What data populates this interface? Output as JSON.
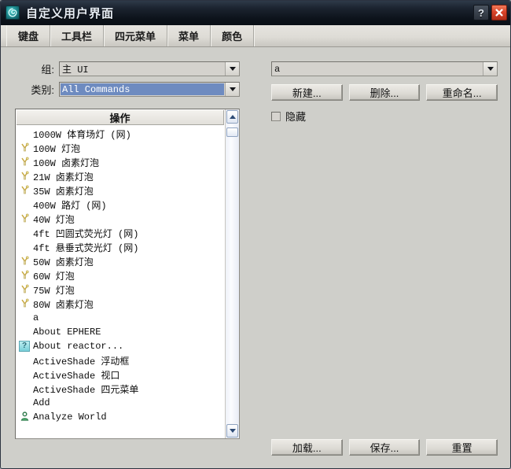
{
  "window": {
    "title": "自定义用户界面",
    "app_icon": "max-swirl-icon",
    "help_label": "?",
    "close_label": "×",
    "frame_color": "#2c3340",
    "body_color": "#cfcfca"
  },
  "tabs": [
    {
      "label": "键盘"
    },
    {
      "label": "工具栏"
    },
    {
      "label": "四元菜单"
    },
    {
      "label": "菜单"
    },
    {
      "label": "颜色"
    }
  ],
  "left_panel": {
    "group": {
      "label": "组:",
      "value": "主 UI"
    },
    "category": {
      "label": "类别:",
      "value": "All Commands",
      "selected": true,
      "highlight_color": "#6e8bc0"
    },
    "list": {
      "header": "操作",
      "rows": [
        {
          "icon": "none",
          "label": "1000W 体育场灯 (网)"
        },
        {
          "icon": "lamp",
          "label": "100W 灯泡"
        },
        {
          "icon": "lamp",
          "label": "100W 卤素灯泡"
        },
        {
          "icon": "lamp",
          "label": "21W 卤素灯泡"
        },
        {
          "icon": "lamp",
          "label": "35W 卤素灯泡"
        },
        {
          "icon": "none",
          "label": "400W 路灯 (网)"
        },
        {
          "icon": "lamp",
          "label": "40W 灯泡"
        },
        {
          "icon": "none",
          "label": "4ft 凹圆式荧光灯 (网)"
        },
        {
          "icon": "none",
          "label": "4ft 悬垂式荧光灯 (网)"
        },
        {
          "icon": "lamp",
          "label": "50W 卤素灯泡"
        },
        {
          "icon": "lamp",
          "label": "60W 灯泡"
        },
        {
          "icon": "lamp",
          "label": "75W 灯泡"
        },
        {
          "icon": "lamp",
          "label": "80W 卤素灯泡"
        },
        {
          "icon": "none",
          "label": "a"
        },
        {
          "icon": "none",
          "label": "About EPHERE"
        },
        {
          "icon": "question",
          "label": "About reactor..."
        },
        {
          "icon": "none",
          "label": "ActiveShade 浮动框"
        },
        {
          "icon": "none",
          "label": "ActiveShade 视口"
        },
        {
          "icon": "none",
          "label": "ActiveShade 四元菜单"
        },
        {
          "icon": "none",
          "label": "Add"
        },
        {
          "icon": "person",
          "label": "Analyze World"
        },
        {
          "icon": "none",
          "label": ""
        }
      ],
      "scrollbar": {
        "up_arrow": "▲",
        "down_arrow": "▼",
        "thumb_position_percent": 1
      }
    }
  },
  "right_panel": {
    "set_combo": {
      "value": "a"
    },
    "buttons": [
      {
        "label": "新建..."
      },
      {
        "label": "删除..."
      },
      {
        "label": "重命名..."
      }
    ],
    "hidden_checkbox": {
      "label": "隐藏",
      "checked": false
    }
  },
  "bottom_buttons": [
    {
      "label": "加载..."
    },
    {
      "label": "保存..."
    },
    {
      "label": "重置"
    }
  ]
}
